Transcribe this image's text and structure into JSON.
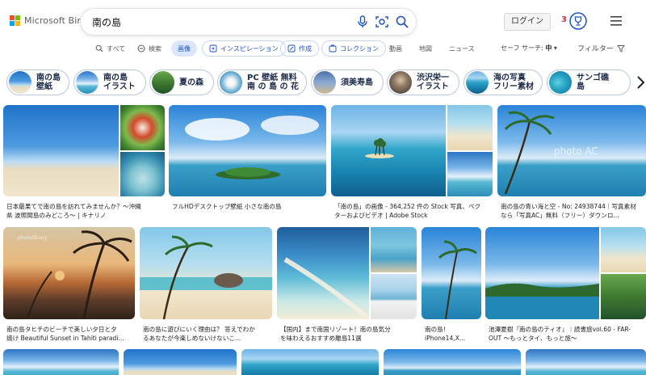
{
  "brand": {
    "name": "Microsoft Bing",
    "colors": [
      "#f25022",
      "#7fba00",
      "#00a4ef",
      "#ffb900"
    ]
  },
  "search": {
    "query": "南の島"
  },
  "header": {
    "login_label": "ログイン",
    "rewards_count": "3"
  },
  "tabs": [
    {
      "label": "すべて",
      "icon": "search-icon"
    },
    {
      "label": "検索",
      "icon": "copilot-icon"
    },
    {
      "label": "画像",
      "icon": ""
    },
    {
      "label": "インスピレーション",
      "icon": "sparkle-icon"
    },
    {
      "label": "作成",
      "icon": "create-icon"
    },
    {
      "label": "コレクション",
      "icon": "collection-icon"
    },
    {
      "label": "動画",
      "icon": ""
    },
    {
      "label": "地図",
      "icon": ""
    },
    {
      "label": "ニュース",
      "icon": ""
    }
  ],
  "safe_search": {
    "label": "セーフ サーチ:",
    "value": "中"
  },
  "filter_label": "フィルター",
  "related": [
    {
      "label": "南の島\n壁紙"
    },
    {
      "label": "南の島\nイラスト"
    },
    {
      "label": "夏の森"
    },
    {
      "label": "PC 壁紙 無料\n南 の 島 の 花"
    },
    {
      "label": "須美寿島"
    },
    {
      "label": "渋沢栄一\nイラスト"
    },
    {
      "label": "海の写真\nフリー素材"
    },
    {
      "label": "サンゴ礁\n島"
    }
  ],
  "results_row1": [
    {
      "caption": [
        "日本最果てで南の島を訪れてみませんか？〜沖縄",
        "県 波照間島のみどころ〜 | キナリノ"
      ]
    },
    {
      "caption": [
        "フルHDデスクトップ壁紙 小さな南の島"
      ]
    },
    {
      "caption": [
        "「南の島」の画像 - 364,252 件の Stock 写真、ベク",
        "ターおよびビデオ | Adobe Stock"
      ]
    },
    {
      "caption": [
        "南の島の青い海と空 - No: 24938744｜写真素材",
        "なら「写真AC」無料（フリー）ダウンロ..."
      ]
    }
  ],
  "results_row2": [
    {
      "caption": [
        "南の島タヒチのビーチで美しい夕日と夕",
        "焼け Beautiful Sunset in Tahiti paradi..."
      ]
    },
    {
      "caption": [
        "南の島に遊びにいく理由は？ 答えでわか",
        "るあなたが今楽しめないけないこ..."
      ]
    },
    {
      "caption": [
        "【国内】まで南国リゾート！南の島気分",
        "を味わえるおすすめ離島11選"
      ]
    },
    {
      "caption": [
        "南の島！",
        "iPhone14,X..."
      ]
    },
    {
      "caption": [
        "池澤夏樹『南の島のティオ』｜読書旅vol.60 - FAR-",
        "OUT 〜もっとタイ、もっと旅〜"
      ]
    }
  ],
  "watermarks": {
    "photo_ac": "photo AC",
    "photolibrary": "photolibrary"
  }
}
